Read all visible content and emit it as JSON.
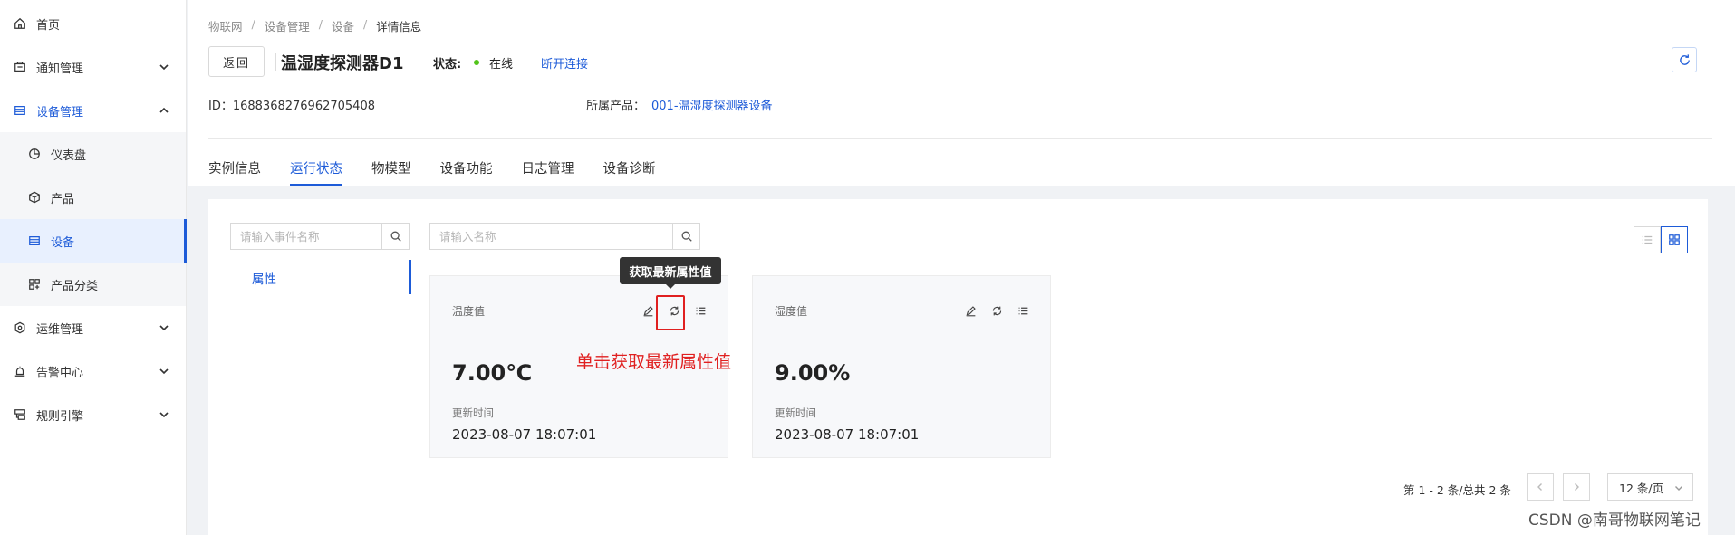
{
  "sidebar": {
    "items": [
      {
        "label": "首页",
        "icon": "home-icon"
      },
      {
        "label": "通知管理",
        "icon": "notice-icon"
      },
      {
        "label": "设备管理",
        "icon": "device-mgmt-icon"
      },
      {
        "label": "仪表盘",
        "icon": "dashboard-icon"
      },
      {
        "label": "产品",
        "icon": "cube-icon"
      },
      {
        "label": "设备",
        "icon": "device-icon"
      },
      {
        "label": "产品分类",
        "icon": "category-icon"
      },
      {
        "label": "运维管理",
        "icon": "ops-icon"
      },
      {
        "label": "告警中心",
        "icon": "alarm-icon"
      },
      {
        "label": "规则引擎",
        "icon": "rule-icon"
      }
    ]
  },
  "breadcrumb": [
    "物联网",
    "设备管理",
    "设备",
    "详情信息"
  ],
  "header": {
    "back_label": "返回",
    "title": "温湿度探测器D1",
    "status_label": "状态:",
    "status_value": "在线",
    "status_color": "#52c41a",
    "disconnect_label": "断开连接",
    "id_text": "ID：1688368276962705408",
    "product_label": "所属产品：",
    "product_link": "001-温湿度探测器设备"
  },
  "tabs": [
    "实例信息",
    "运行状态",
    "物模型",
    "设备功能",
    "日志管理",
    "设备诊断"
  ],
  "content": {
    "event_search_placeholder": "请输入事件名称",
    "name_search_placeholder": "请输入名称",
    "side_item": "属性",
    "cards": [
      {
        "name": "温度值",
        "value": "7.00℃",
        "update_label": "更新时间",
        "update_time": "2023-08-07 18:07:01"
      },
      {
        "name": "湿度值",
        "value": "9.00%",
        "update_label": "更新时间",
        "update_time": "2023-08-07 18:07:01"
      }
    ],
    "tooltip": "获取最新属性值",
    "annotation": "单击获取最新属性值",
    "pagination_text": "第 1 - 2 条/总共 2 条",
    "page_size": "12 条/页"
  },
  "watermark": "CSDN @南哥物联网笔记",
  "colors": {
    "accent": "#1d5bd8",
    "annotation": "#e02020"
  }
}
